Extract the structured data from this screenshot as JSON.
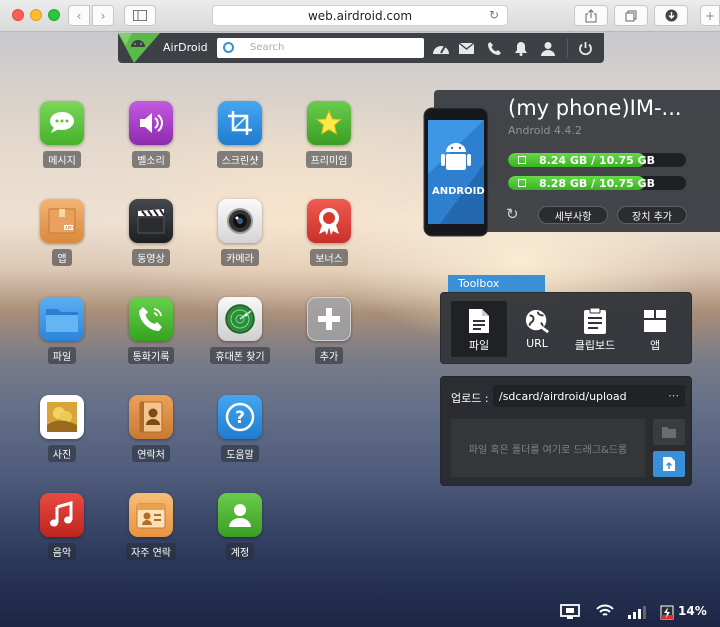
{
  "browser": {
    "url": "web.airdroid.com"
  },
  "toolbar": {
    "brand": "AirDroid",
    "search_placeholder": "Search"
  },
  "apps": [
    {
      "label": "메시지",
      "icon": "message-icon",
      "color": "#5cc43a"
    },
    {
      "label": "벨소리",
      "icon": "speaker-icon",
      "color": "#a83fc7"
    },
    {
      "label": "스크린샷",
      "icon": "crop-icon",
      "color": "#2a8ee0"
    },
    {
      "label": "프리미엄",
      "icon": "star-icon",
      "color": "#4ab534"
    },
    {
      "label": "앱",
      "icon": "app-box-icon",
      "color": "#e8a05a"
    },
    {
      "label": "동영상",
      "icon": "clapperboard-icon",
      "color": "#2b2d31"
    },
    {
      "label": "카메라",
      "icon": "camera-icon",
      "color": "#e9e9e9"
    },
    {
      "label": "보너스",
      "icon": "badge-icon",
      "color": "#e04338"
    },
    {
      "label": "파일",
      "icon": "folder-icon",
      "color": "#3a90e0"
    },
    {
      "label": "통화기록",
      "icon": "phone-icon",
      "color": "#46b93a"
    },
    {
      "label": "휴대폰 찾기",
      "icon": "radar-icon",
      "color": "#e4e4e4"
    },
    {
      "label": "추가",
      "icon": "plus-icon",
      "color": "#9a9da2"
    },
    {
      "label": "사진",
      "icon": "photo-icon",
      "color": "#e8c54c"
    },
    {
      "label": "연락처",
      "icon": "contacts-book-icon",
      "color": "#d98a3c"
    },
    {
      "label": "도움말",
      "icon": "help-icon",
      "color": "#2a8ee0"
    },
    {
      "label": "음악",
      "icon": "music-icon",
      "color": "#d82f2a"
    },
    {
      "label": "자주 연락",
      "icon": "frequent-contact-icon",
      "color": "#f0a552"
    },
    {
      "label": "계정",
      "icon": "account-icon",
      "color": "#4ab534"
    }
  ],
  "device": {
    "name": "(my phone)IM-...",
    "android_version": "Android 4.4.2",
    "phone_label": "ANDROID",
    "storage": [
      {
        "text": "8.24 GB / 10.75 GB",
        "fill": 0.77
      },
      {
        "text": "8.28 GB / 10.75 GB",
        "fill": 0.77
      }
    ],
    "details_button": "세부사항",
    "add_device_button": "장치 추가"
  },
  "toolbox": {
    "tab": "Toolbox",
    "tools": [
      {
        "label": "파일",
        "icon": "file-icon",
        "selected": true
      },
      {
        "label": "URL",
        "icon": "globe-icon",
        "selected": false
      },
      {
        "label": "클립보드",
        "icon": "clipboard-icon",
        "selected": false
      },
      {
        "label": "앱",
        "icon": "app-box-icon",
        "selected": false
      }
    ],
    "upload_label": "업로드 :",
    "upload_path": "/sdcard/airdroid/upload",
    "dropzone_text": "파일 혹은 폴더를 여기로 드래그&드롭"
  },
  "status": {
    "battery": "14%"
  }
}
